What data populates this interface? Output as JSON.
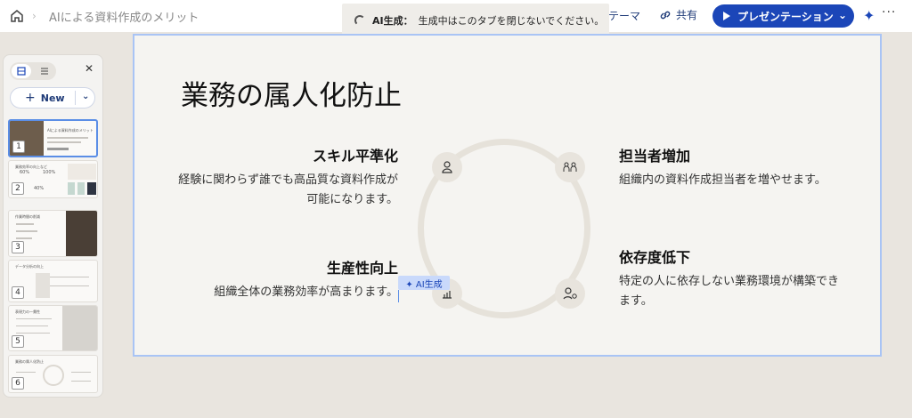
{
  "header": {
    "doc_title": "AIによる資料作成のメリット",
    "generating_label": "AI生成：",
    "generating_message": "生成中はこのタブを閉じないでください。",
    "theme_label": "テーマ",
    "share_label": "共有",
    "present_label": "プレゼンテーション"
  },
  "sidebar": {
    "new_label": "New",
    "thumbnails": [
      {
        "number": "1",
        "title": "AIによる資料作成のメリット"
      },
      {
        "number": "2",
        "title": "業務効率の向上など",
        "stat_a": "60%",
        "stat_b": "100%",
        "stat_c": "40%"
      },
      {
        "number": "3",
        "title": "作業時間の削減"
      },
      {
        "number": "4",
        "title": "データ分析の向上"
      },
      {
        "number": "5",
        "title": "表現力の一貫性"
      },
      {
        "number": "6",
        "title": "業務の属人化防止"
      }
    ]
  },
  "slide": {
    "title": "業務の属人化防止",
    "items": [
      {
        "heading": "スキル平準化",
        "body": "経験に関わらず誰でも高品質な資料作成が可能になります。",
        "icon": "person-icon"
      },
      {
        "heading": "担当者増加",
        "body": "組織内の資料作成担当者を増やせます。",
        "icon": "people-icon"
      },
      {
        "heading": "生産性向上",
        "body": "組織全体の業務効率が高まります。",
        "icon": "chart-icon"
      },
      {
        "heading": "依存度低下",
        "body": "特定の人に依存しない業務環境が構築できます。",
        "icon": "user-settings-icon"
      }
    ],
    "ai_tag": "✦ AI生成"
  },
  "colors": {
    "accent": "#1b46b8",
    "selection": "#a9c4f5",
    "ring": "#e6e2da"
  }
}
